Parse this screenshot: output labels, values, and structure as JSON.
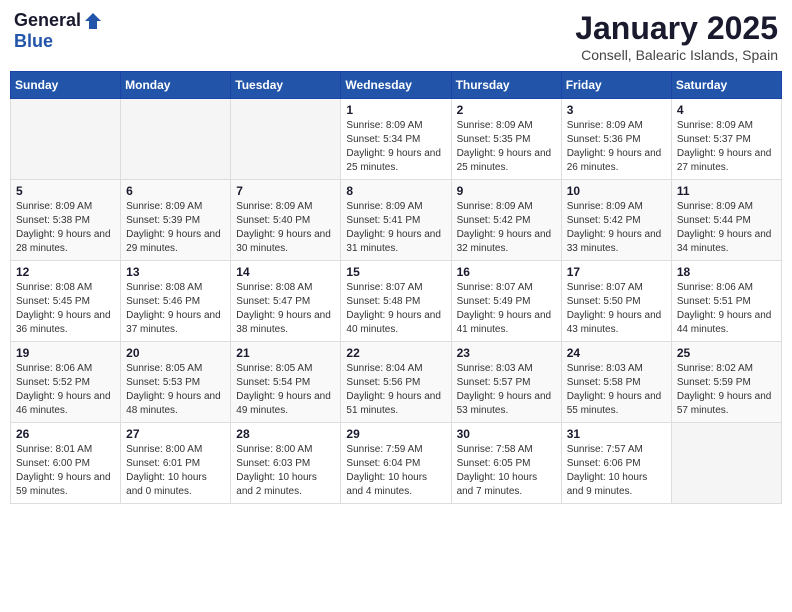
{
  "logo": {
    "general": "General",
    "blue": "Blue"
  },
  "title": "January 2025",
  "location": "Consell, Balearic Islands, Spain",
  "days_of_week": [
    "Sunday",
    "Monday",
    "Tuesday",
    "Wednesday",
    "Thursday",
    "Friday",
    "Saturday"
  ],
  "weeks": [
    [
      {
        "day": "",
        "info": ""
      },
      {
        "day": "",
        "info": ""
      },
      {
        "day": "",
        "info": ""
      },
      {
        "day": "1",
        "info": "Sunrise: 8:09 AM\nSunset: 5:34 PM\nDaylight: 9 hours and 25 minutes."
      },
      {
        "day": "2",
        "info": "Sunrise: 8:09 AM\nSunset: 5:35 PM\nDaylight: 9 hours and 25 minutes."
      },
      {
        "day": "3",
        "info": "Sunrise: 8:09 AM\nSunset: 5:36 PM\nDaylight: 9 hours and 26 minutes."
      },
      {
        "day": "4",
        "info": "Sunrise: 8:09 AM\nSunset: 5:37 PM\nDaylight: 9 hours and 27 minutes."
      }
    ],
    [
      {
        "day": "5",
        "info": "Sunrise: 8:09 AM\nSunset: 5:38 PM\nDaylight: 9 hours and 28 minutes."
      },
      {
        "day": "6",
        "info": "Sunrise: 8:09 AM\nSunset: 5:39 PM\nDaylight: 9 hours and 29 minutes."
      },
      {
        "day": "7",
        "info": "Sunrise: 8:09 AM\nSunset: 5:40 PM\nDaylight: 9 hours and 30 minutes."
      },
      {
        "day": "8",
        "info": "Sunrise: 8:09 AM\nSunset: 5:41 PM\nDaylight: 9 hours and 31 minutes."
      },
      {
        "day": "9",
        "info": "Sunrise: 8:09 AM\nSunset: 5:42 PM\nDaylight: 9 hours and 32 minutes."
      },
      {
        "day": "10",
        "info": "Sunrise: 8:09 AM\nSunset: 5:42 PM\nDaylight: 9 hours and 33 minutes."
      },
      {
        "day": "11",
        "info": "Sunrise: 8:09 AM\nSunset: 5:44 PM\nDaylight: 9 hours and 34 minutes."
      }
    ],
    [
      {
        "day": "12",
        "info": "Sunrise: 8:08 AM\nSunset: 5:45 PM\nDaylight: 9 hours and 36 minutes."
      },
      {
        "day": "13",
        "info": "Sunrise: 8:08 AM\nSunset: 5:46 PM\nDaylight: 9 hours and 37 minutes."
      },
      {
        "day": "14",
        "info": "Sunrise: 8:08 AM\nSunset: 5:47 PM\nDaylight: 9 hours and 38 minutes."
      },
      {
        "day": "15",
        "info": "Sunrise: 8:07 AM\nSunset: 5:48 PM\nDaylight: 9 hours and 40 minutes."
      },
      {
        "day": "16",
        "info": "Sunrise: 8:07 AM\nSunset: 5:49 PM\nDaylight: 9 hours and 41 minutes."
      },
      {
        "day": "17",
        "info": "Sunrise: 8:07 AM\nSunset: 5:50 PM\nDaylight: 9 hours and 43 minutes."
      },
      {
        "day": "18",
        "info": "Sunrise: 8:06 AM\nSunset: 5:51 PM\nDaylight: 9 hours and 44 minutes."
      }
    ],
    [
      {
        "day": "19",
        "info": "Sunrise: 8:06 AM\nSunset: 5:52 PM\nDaylight: 9 hours and 46 minutes."
      },
      {
        "day": "20",
        "info": "Sunrise: 8:05 AM\nSunset: 5:53 PM\nDaylight: 9 hours and 48 minutes."
      },
      {
        "day": "21",
        "info": "Sunrise: 8:05 AM\nSunset: 5:54 PM\nDaylight: 9 hours and 49 minutes."
      },
      {
        "day": "22",
        "info": "Sunrise: 8:04 AM\nSunset: 5:56 PM\nDaylight: 9 hours and 51 minutes."
      },
      {
        "day": "23",
        "info": "Sunrise: 8:03 AM\nSunset: 5:57 PM\nDaylight: 9 hours and 53 minutes."
      },
      {
        "day": "24",
        "info": "Sunrise: 8:03 AM\nSunset: 5:58 PM\nDaylight: 9 hours and 55 minutes."
      },
      {
        "day": "25",
        "info": "Sunrise: 8:02 AM\nSunset: 5:59 PM\nDaylight: 9 hours and 57 minutes."
      }
    ],
    [
      {
        "day": "26",
        "info": "Sunrise: 8:01 AM\nSunset: 6:00 PM\nDaylight: 9 hours and 59 minutes."
      },
      {
        "day": "27",
        "info": "Sunrise: 8:00 AM\nSunset: 6:01 PM\nDaylight: 10 hours and 0 minutes."
      },
      {
        "day": "28",
        "info": "Sunrise: 8:00 AM\nSunset: 6:03 PM\nDaylight: 10 hours and 2 minutes."
      },
      {
        "day": "29",
        "info": "Sunrise: 7:59 AM\nSunset: 6:04 PM\nDaylight: 10 hours and 4 minutes."
      },
      {
        "day": "30",
        "info": "Sunrise: 7:58 AM\nSunset: 6:05 PM\nDaylight: 10 hours and 7 minutes."
      },
      {
        "day": "31",
        "info": "Sunrise: 7:57 AM\nSunset: 6:06 PM\nDaylight: 10 hours and 9 minutes."
      },
      {
        "day": "",
        "info": ""
      }
    ]
  ]
}
